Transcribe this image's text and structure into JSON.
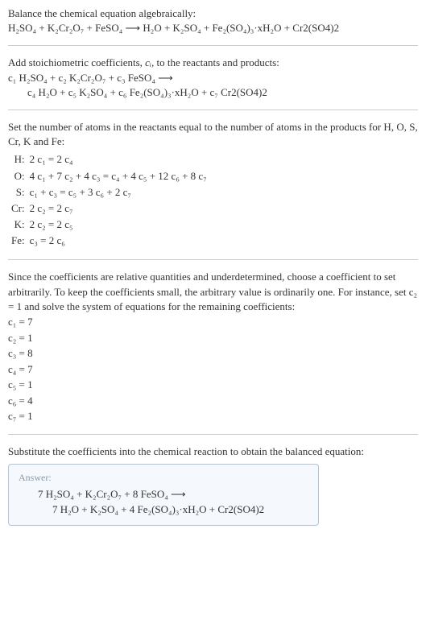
{
  "intro": {
    "balance_text": "Balance the chemical equation algebraically:",
    "eq1_left": "H₂SO₄ + K₂Cr₂O₇ + FeSO₄",
    "eq1_arrow": "⟶",
    "eq1_right": "H₂O + K₂SO₄ + Fe₂(SO₄)₃·xH₂O + Cr2(SO4)2"
  },
  "stoich": {
    "add_text": "Add stoichiometric coefficients, ",
    "ci": "cᵢ",
    "add_text2": ", to the reactants and products:",
    "line1": "c₁ H₂SO₄ + c₂ K₂Cr₂O₇ + c₃ FeSO₄  ⟶",
    "line2": "c₄ H₂O + c₅ K₂SO₄ + c₆ Fe₂(SO₄)₃·xH₂O + c₇ Cr2(SO4)2"
  },
  "atoms": {
    "intro": "Set the number of atoms in the reactants equal to the number of atoms in the products for H, O, S, Cr, K and Fe:",
    "rows": [
      {
        "el": "H:",
        "eq": "2 c₁ = 2 c₄"
      },
      {
        "el": "O:",
        "eq": "4 c₁ + 7 c₂ + 4 c₃ = c₄ + 4 c₅ + 12 c₆ + 8 c₇"
      },
      {
        "el": "S:",
        "eq": "c₁ + c₃ = c₅ + 3 c₆ + 2 c₇"
      },
      {
        "el": "Cr:",
        "eq": "2 c₂ = 2 c₇"
      },
      {
        "el": "K:",
        "eq": "2 c₂ = 2 c₅"
      },
      {
        "el": "Fe:",
        "eq": "c₃ = 2 c₆"
      }
    ]
  },
  "solve": {
    "para": "Since the coefficients are relative quantities and underdetermined, choose a coefficient to set arbitrarily. To keep the coefficients small, the arbitrary value is ordinarily one. For instance, set c₂ = 1 and solve the system of equations for the remaining coefficients:",
    "coeffs": [
      "c₁ = 7",
      "c₂ = 1",
      "c₃ = 8",
      "c₄ = 7",
      "c₅ = 1",
      "c₆ = 4",
      "c₇ = 1"
    ]
  },
  "final": {
    "para": "Substitute the coefficients into the chemical reaction to obtain the balanced equation:",
    "answer_label": "Answer:",
    "eq_line1": "7 H₂SO₄ + K₂Cr₂O₇ + 8 FeSO₄  ⟶",
    "eq_line2": "7 H₂O + K₂SO₄ + 4 Fe₂(SO₄)₃·xH₂O + Cr2(SO4)2"
  }
}
